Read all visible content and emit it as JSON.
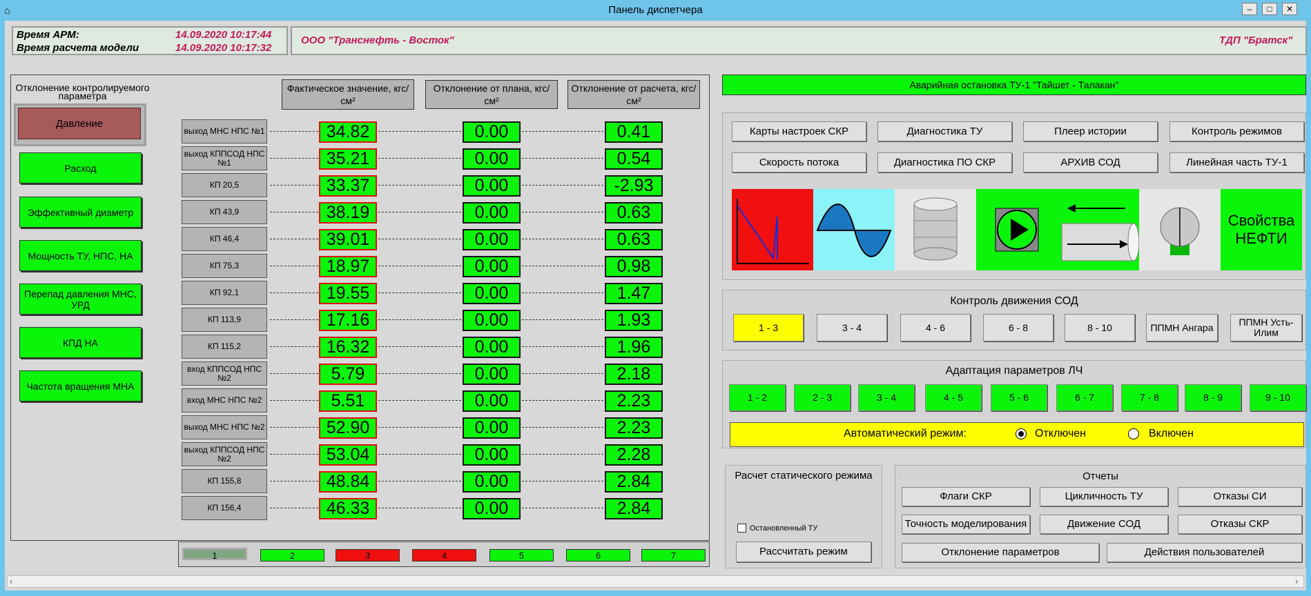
{
  "window": {
    "title": "Панель диспетчера",
    "min": "–",
    "max": "□",
    "close": "✕"
  },
  "header": {
    "arm_label": "Время АРМ:",
    "arm_time": "14.09.2020 10:17:44",
    "model_label": "Время расчета модели",
    "model_time": "14.09.2020 10:17:32",
    "company": "ООО \"Транснефть - Восток\"",
    "tdp": "ТДП \"Братск\""
  },
  "left": {
    "param_title": "Отклонение контролируемого параметра",
    "params": [
      "Давление",
      "Расход",
      "Эффективный диаметр",
      "Мощность ТУ, НПС, НА",
      "Перепад давления МНС, УРД",
      "КПД НА",
      "Частота вращения МНА"
    ],
    "col_headers": [
      "Фактическое значение, кгс/см²",
      "Отклонение от плана, кгс/см²",
      "Отклонение от расчета, кгс/см²"
    ],
    "rows": [
      {
        "label": "выход МНС НПС №1",
        "fact": "34.82",
        "plan": "0.00",
        "calc": "0.41"
      },
      {
        "label": "выход КППСОД НПС №1",
        "fact": "35.21",
        "plan": "0.00",
        "calc": "0.54"
      },
      {
        "label": "КП 20,5",
        "fact": "33.37",
        "plan": "0.00",
        "calc": "-2.93"
      },
      {
        "label": "КП 43,9",
        "fact": "38.19",
        "plan": "0.00",
        "calc": "0.63"
      },
      {
        "label": "КП 46,4",
        "fact": "39.01",
        "plan": "0.00",
        "calc": "0.63"
      },
      {
        "label": "КП 75,3",
        "fact": "18.97",
        "plan": "0.00",
        "calc": "0.98"
      },
      {
        "label": "КП 92,1",
        "fact": "19.55",
        "plan": "0.00",
        "calc": "1.47"
      },
      {
        "label": "КП 113,9",
        "fact": "17.16",
        "plan": "0.00",
        "calc": "1.93"
      },
      {
        "label": "КП 115,2",
        "fact": "16.32",
        "plan": "0.00",
        "calc": "1.96"
      },
      {
        "label": "вход КППСОД НПС №2",
        "fact": "5.79",
        "plan": "0.00",
        "calc": "2.18"
      },
      {
        "label": "вход МНС НПС №2",
        "fact": "5.51",
        "plan": "0.00",
        "calc": "2.23"
      },
      {
        "label": "выход МНС НПС №2",
        "fact": "52.90",
        "plan": "0.00",
        "calc": "2.23"
      },
      {
        "label": "выход КППСОД НПС №2",
        "fact": "53.04",
        "plan": "0.00",
        "calc": "2.28"
      },
      {
        "label": "КП 155,8",
        "fact": "48.84",
        "plan": "0.00",
        "calc": "2.84"
      },
      {
        "label": "КП 156,4",
        "fact": "46.33",
        "plan": "0.00",
        "calc": "2.84"
      }
    ],
    "pages": [
      {
        "label": "1",
        "color": "#7fa67f"
      },
      {
        "label": "2",
        "color": "#0bf50b"
      },
      {
        "label": "3",
        "color": "#f01010"
      },
      {
        "label": "4",
        "color": "#f01010"
      },
      {
        "label": "5",
        "color": "#0bf50b"
      },
      {
        "label": "6",
        "color": "#0bf50b"
      },
      {
        "label": "7",
        "color": "#0bf50b"
      }
    ]
  },
  "right": {
    "alarm": "Аварийная остановка ТУ-1 \"Тайшет - Талакан\"",
    "nav_buttons": [
      "Карты настроек СКР",
      "Диагностика ТУ",
      "Плеер истории",
      "Контроль режимов",
      "Скорость потока",
      "Диагностика ПО СКР",
      "АРХИВ СОД",
      "Линейная часть ТУ-1"
    ],
    "icons": [
      "pressure-profile-icon",
      "wave-icon",
      "database-icon",
      "pump-icon",
      "pipe-flow-icon",
      "valve-icon"
    ],
    "oil_props": "Свойства НЕФТИ",
    "sod_title": "Контроль движения СОД",
    "sod_buttons": [
      "1 - 3",
      "3 - 4",
      "4 - 6",
      "6 - 8",
      "8 - 10",
      "ППМН Ангара",
      "ППМН Усть-Илим"
    ],
    "adapt_title": "Адаптация параметров ЛЧ",
    "adapt_buttons": [
      "1 - 2",
      "2 - 3",
      "3 - 4",
      "4 - 5",
      "5 - 6",
      "6 - 7",
      "7 - 8",
      "8 - 9",
      "9 - 10"
    ],
    "auto_label": "Автоматический режим:",
    "auto_off": "Отключен",
    "auto_on": "Включен",
    "static_title": "Расчет статического режима",
    "stopped_tu": "Остановленный ТУ",
    "calc_button": "Рассчитать режим",
    "reports_title": "Отчеты",
    "report_buttons": [
      "Флаги СКР",
      "Цикличность ТУ",
      "Отказы СИ",
      "Точность моделирования",
      "Движение СОД",
      "Отказы СКР",
      "Отклонение параметров",
      "Действия пользователей"
    ]
  },
  "colors": {
    "green": "#0bf50b",
    "yellow": "#ffff00",
    "red": "#f01010",
    "titlebar": "#6fc4ea",
    "magenta": "#c2185b"
  }
}
